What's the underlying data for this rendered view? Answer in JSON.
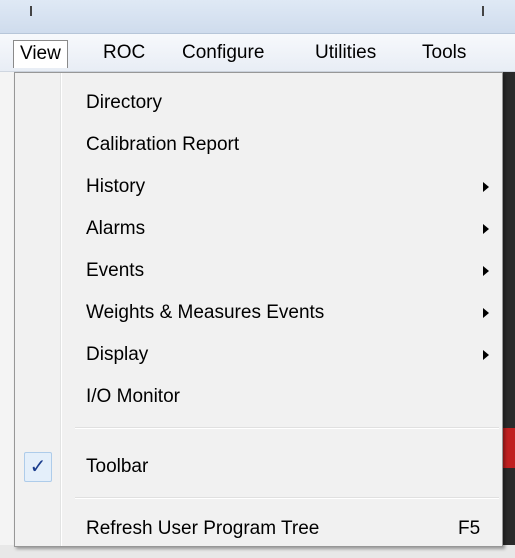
{
  "menubar": {
    "items": [
      {
        "label": "View",
        "active": true
      },
      {
        "label": "ROC"
      },
      {
        "label": "Configure"
      },
      {
        "label": "Utilities"
      },
      {
        "label": "Tools"
      }
    ]
  },
  "view_menu": {
    "items": [
      {
        "label": "Directory"
      },
      {
        "label": "Calibration Report"
      },
      {
        "label": "History",
        "submenu": true
      },
      {
        "label": "Alarms",
        "submenu": true
      },
      {
        "label": "Events",
        "submenu": true
      },
      {
        "label": "Weights & Measures Events",
        "submenu": true
      },
      {
        "label": "Display",
        "submenu": true
      },
      {
        "label": "I/O Monitor"
      },
      {
        "label": "Toolbar",
        "checked": true,
        "check_glyph": "✓"
      },
      {
        "label": "Refresh User Program Tree",
        "shortcut": "F5"
      }
    ]
  }
}
